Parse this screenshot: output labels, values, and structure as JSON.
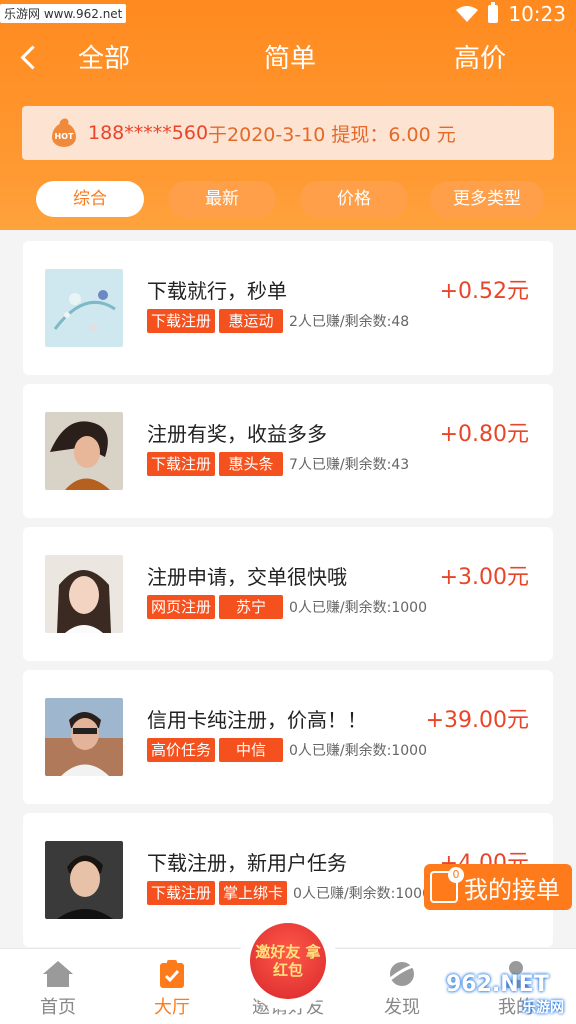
{
  "status_bar": {
    "badge": "乐游网 www.962.net",
    "time": "10:23"
  },
  "nav": {
    "tabs": [
      "全部",
      "简单",
      "高价"
    ]
  },
  "notice": {
    "phone": "188*****560",
    "rest": "于2020-3-10 提现：6.00 元"
  },
  "filters": {
    "items": [
      "综合",
      "最新",
      "价格",
      "更多类型"
    ],
    "active_index": 0
  },
  "tasks": [
    {
      "title": "下载就行，秒单",
      "tag1": "下载注册",
      "tag2": "惠运动",
      "stat": "2人已赚/剩余数:48",
      "price": "+0.52元",
      "thumb": "sky-art-thumb"
    },
    {
      "title": "注册有奖，收益多多",
      "tag1": "下载注册",
      "tag2": "惠头条",
      "stat": "7人已赚/剩余数:43",
      "price": "+0.80元",
      "thumb": "woman-windblown-thumb"
    },
    {
      "title": "注册申请，交单很快哦",
      "tag1": "网页注册",
      "tag2": "苏宁",
      "stat": "0人已赚/剩余数:1000",
      "price": "+3.00元",
      "thumb": "woman-smile-thumb"
    },
    {
      "title": "信用卡纯注册，价高！！",
      "tag1": "高价任务",
      "tag2": "中信",
      "stat": "0人已赚/剩余数:1000",
      "price": "+39.00元",
      "thumb": "man-sunglasses-thumb"
    },
    {
      "title": "下载注册，新用户任务",
      "tag1": "下载注册",
      "tag2": "掌上绑卡",
      "stat": "0人已赚/剩余数:1000",
      "price": "+4.00元",
      "thumb": "man-portrait-thumb"
    }
  ],
  "float_button": {
    "label": "我的接单",
    "count": "0"
  },
  "tabbar": {
    "items": [
      {
        "label": "首页",
        "icon": "home-icon"
      },
      {
        "label": "大厅",
        "icon": "task-clipboard-icon"
      },
      {
        "label": "邀请好友",
        "icon": "invite-icon"
      },
      {
        "label": "发现",
        "icon": "discover-icon"
      },
      {
        "label": "我的",
        "icon": "user-icon"
      }
    ],
    "active_index": 1,
    "center_badge": "邀好友 拿红包"
  },
  "watermark": {
    "main": "962.NET",
    "sub": "乐游网"
  },
  "colors": {
    "primary": "#ff8a1f",
    "price": "#e8452a",
    "tag": "#f4511e"
  }
}
